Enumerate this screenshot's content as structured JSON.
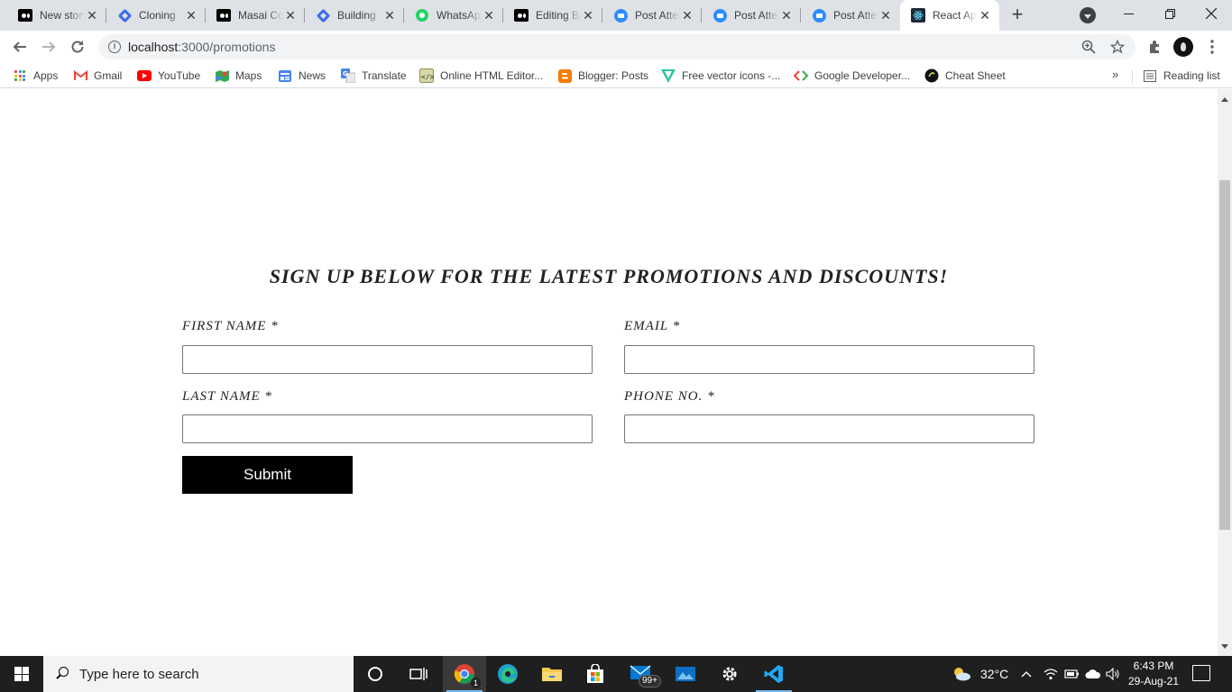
{
  "browser": {
    "tabs": [
      {
        "title": "New story – Medium",
        "favicon": "medium-icon"
      },
      {
        "title": "Cloning",
        "favicon": "diamond-icon"
      },
      {
        "title": "Masai Course",
        "favicon": "medium-icon"
      },
      {
        "title": "Building",
        "favicon": "diamond-icon"
      },
      {
        "title": "WhatsApp",
        "favicon": "whatsapp-icon"
      },
      {
        "title": "Editing Blog",
        "favicon": "medium-icon"
      },
      {
        "title": "Post Attendance",
        "favicon": "zoom-icon"
      },
      {
        "title": "Post Attendance",
        "favicon": "zoom-icon"
      },
      {
        "title": "Post Attendance",
        "favicon": "zoom-icon"
      },
      {
        "title": "React App",
        "favicon": "react-icon",
        "active": true
      }
    ],
    "address": {
      "host": "localhost",
      "path": ":3000/promotions"
    },
    "bookmarks": [
      {
        "label": "Apps",
        "icon": "apps-grid-icon"
      },
      {
        "label": "Gmail",
        "icon": "gmail-icon"
      },
      {
        "label": "YouTube",
        "icon": "youtube-icon"
      },
      {
        "label": "Maps",
        "icon": "maps-icon"
      },
      {
        "label": "News",
        "icon": "news-icon"
      },
      {
        "label": "Translate",
        "icon": "translate-icon"
      },
      {
        "label": "Online HTML Editor...",
        "icon": "html-editor-icon"
      },
      {
        "label": "Blogger: Posts",
        "icon": "blogger-icon"
      },
      {
        "label": "Free vector icons -...",
        "icon": "vector-icon"
      },
      {
        "label": "Google Developer...",
        "icon": "google-dev-icon"
      },
      {
        "label": "Cheat Sheet",
        "icon": "cheat-sheet-icon"
      }
    ],
    "reading_list": "Reading list"
  },
  "page": {
    "heading": "SIGN UP BELOW FOR THE LATEST PROMOTIONS AND DISCOUNTS!",
    "fields": {
      "first_name": {
        "label": "FIRST NAME *",
        "value": ""
      },
      "email": {
        "label": "EMAIL *",
        "value": ""
      },
      "last_name": {
        "label": "LAST NAME *",
        "value": ""
      },
      "phone": {
        "label": "PHONE NO. *",
        "value": ""
      }
    },
    "submit": "Submit"
  },
  "taskbar": {
    "search_placeholder": "Type here to search",
    "chrome_badge": "1",
    "mail_badge": "99+",
    "weather": "32°C",
    "time": "6:43 PM",
    "date": "29-Aug-21"
  },
  "colors": {
    "tabstrip": "#dee1e6",
    "submit_bg": "#000000",
    "taskbar": "#1f1f1f",
    "accent": "#76b9ed"
  }
}
